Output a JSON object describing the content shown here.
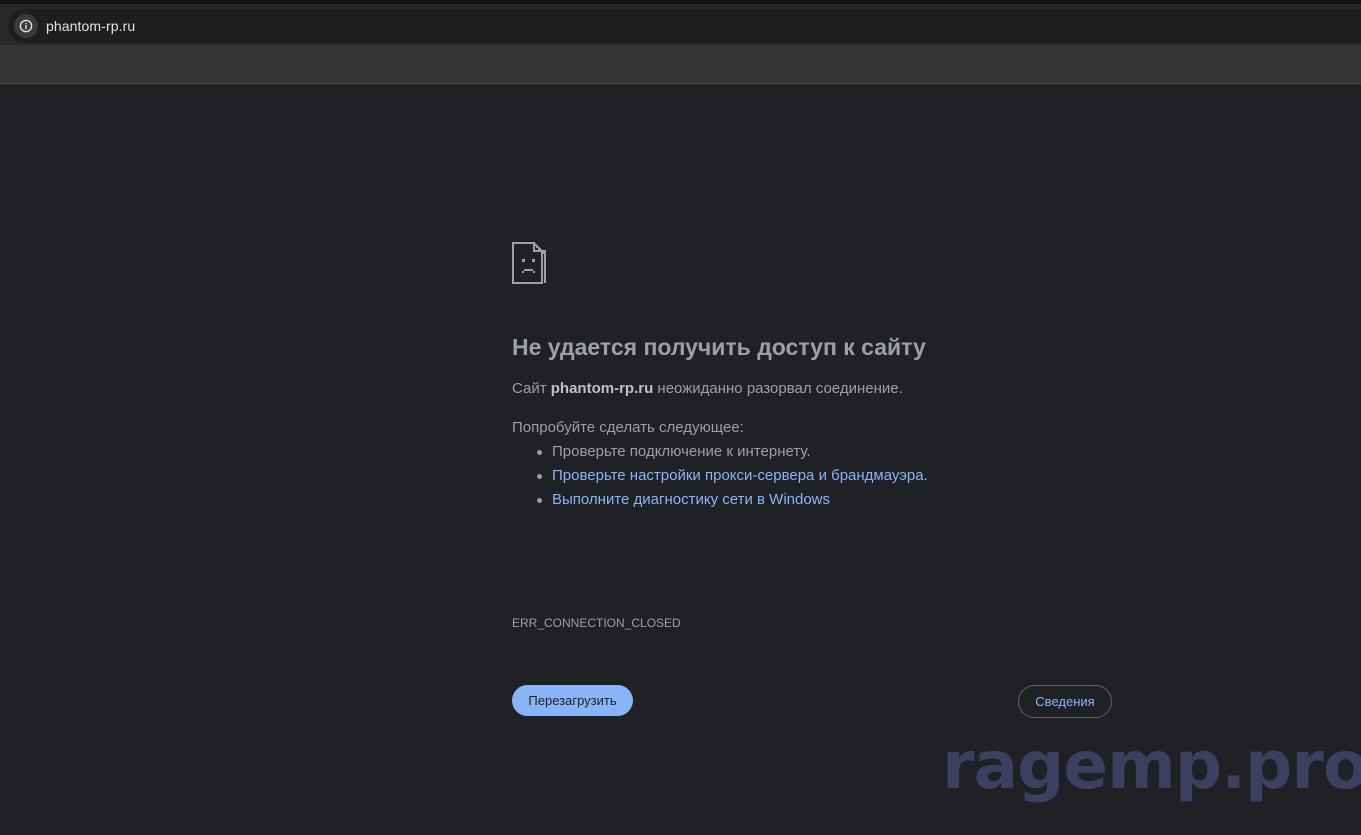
{
  "browser": {
    "url": "phantom-rp.ru",
    "info_icon": "info-icon"
  },
  "error_page": {
    "icon": "sad-page-icon",
    "title": "Не удается получить доступ к сайту",
    "summary_prefix": "Сайт ",
    "summary_host": "phantom-rp.ru",
    "summary_suffix": " неожиданно разорвал соединение.",
    "suggestions_heading": "Попробуйте сделать следующее:",
    "suggestions": [
      {
        "text": "Проверьте подключение к интернету.",
        "link": "",
        "after": ""
      },
      {
        "text": "",
        "link": "Проверьте настройки прокси-сервера и брандмауэра",
        "after": "."
      },
      {
        "text": "",
        "link": "Выполните диагностику сети в Windows",
        "after": ""
      }
    ],
    "error_code": "ERR_CONNECTION_CLOSED",
    "reload_label": "Перезагрузить",
    "details_label": "Сведения"
  },
  "watermark": "ragemp.pro",
  "colors": {
    "page_background": "#202124",
    "text": "#9aa0a6",
    "link": "#8ab4f8",
    "button_primary": "#8ab4f8"
  }
}
